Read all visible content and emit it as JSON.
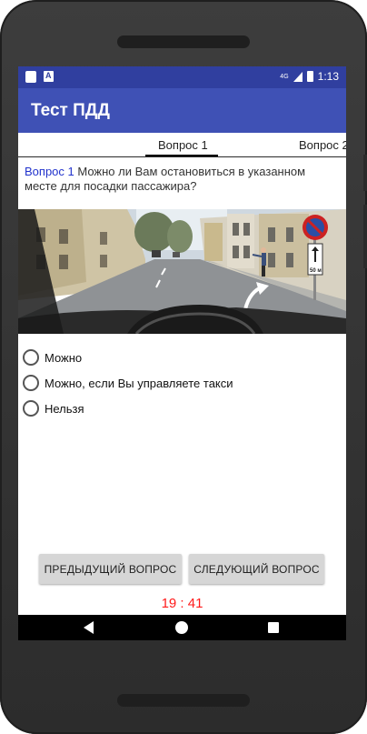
{
  "status_bar": {
    "network": "4G",
    "time": "1:13"
  },
  "app_bar": {
    "title": "Тест ПДД"
  },
  "tabs": [
    {
      "label": "Вопрос 1",
      "selected": true
    },
    {
      "label": "Вопрос 2",
      "selected": false
    }
  ],
  "question": {
    "number_label": "Вопрос 1",
    "text": "Можно ли Вам остановиться в указанном месте для посадки пассажира?"
  },
  "image": {
    "sign_text": "50 м"
  },
  "answers": [
    {
      "label": "Можно",
      "selected": false
    },
    {
      "label": "Можно, если Вы управляете такси",
      "selected": false
    },
    {
      "label": "Нельзя",
      "selected": false
    }
  ],
  "buttons": {
    "prev": "ПРЕДЫДУЩИЙ ВОПРОС",
    "next": "СЛЕДУЮЩИЙ ВОПРОС"
  },
  "timer": "19 : 41",
  "colors": {
    "status_bar": "#303f9f",
    "app_bar": "#3f51b5",
    "timer": "#ff1a1a",
    "question_number": "#2233cc"
  },
  "nav_icons": [
    "back-icon",
    "home-icon",
    "recents-icon"
  ]
}
